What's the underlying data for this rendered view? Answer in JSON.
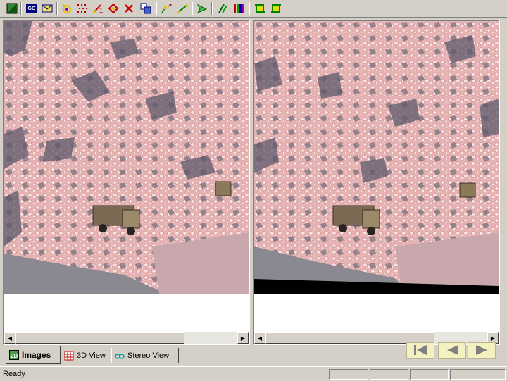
{
  "toolbar": {
    "icons": [
      "green-square-icon",
      "go-icon",
      "envelope-icon",
      "rotate-icon",
      "point-grid-icon",
      "line-point-icon",
      "marker-icon",
      "delete-x-icon",
      "blocks-icon",
      "edit-points-icon",
      "connect-points-icon",
      "forward-arrow-icon",
      "dtm-icon",
      "color-bars-icon",
      "frame-icon",
      "frame-fit-icon"
    ],
    "go_label": "GO"
  },
  "tabs": [
    {
      "label": "Images",
      "icon": "images-tab-icon",
      "active": true
    },
    {
      "label": "3D View",
      "icon": "3d-view-icon",
      "active": false
    },
    {
      "label": "Stereo View",
      "icon": "stereo-glasses-icon",
      "active": false
    }
  ],
  "nav": {
    "first_icon": "first-page-icon",
    "prev_icon": "previous-icon",
    "next_icon": "next-icon"
  },
  "status": {
    "text": "Ready"
  },
  "colors": {
    "chrome": "#d4d0c8",
    "nav_bg": "#f4f0c0",
    "nav_icon": "#808080",
    "overlay": "#f4b8b8"
  }
}
